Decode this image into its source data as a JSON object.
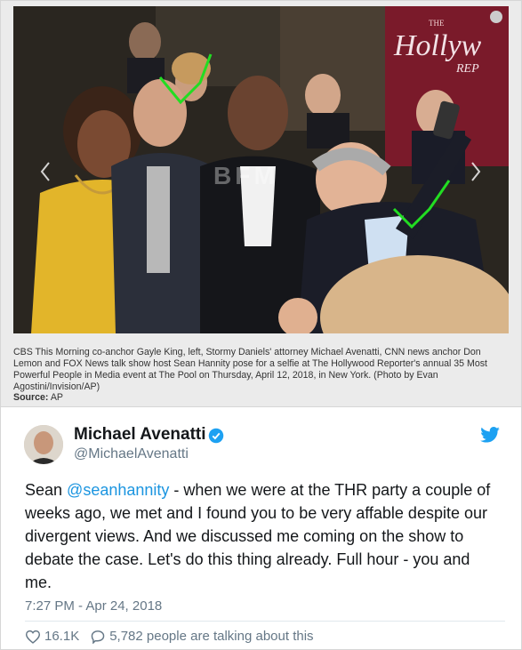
{
  "photo": {
    "watermark": "BFM",
    "magazine_title": "Hollyw",
    "magazine_the": "THE",
    "magazine_sub": "REP",
    "caption": "CBS This Morning co-anchor Gayle King, left, Stormy Daniels' attorney Michael Avenatti, CNN news anchor Don Lemon and FOX News talk show host Sean Hannity pose for a selfie at The Hollywood Reporter's annual 35 Most Powerful People in Media event at The Pool on Thursday, April 12, 2018, in New York. (Photo by Evan Agostini/Invision/AP)",
    "source_label": "Source:",
    "source_value": "AP"
  },
  "tweet": {
    "name": "Michael Avenatti",
    "handle": "@MichaelAvenatti",
    "text_before": "Sean ",
    "mention": "@seanhannity",
    "text_after": " - when we were at the THR party a couple of weeks ago, we met and I found you to be very affable despite our divergent views. And we discussed me coming on the show to debate the case. Let's do this thing already. Full hour - you and me.",
    "timestamp": "7:27 PM - Apr 24, 2018",
    "likes": "16.1K",
    "replies_text": "5,782 people are talking about this"
  },
  "colors": {
    "link_blue": "#1b95e0",
    "verified_blue": "#1da1f2",
    "annotation_green": "#22dd22"
  }
}
